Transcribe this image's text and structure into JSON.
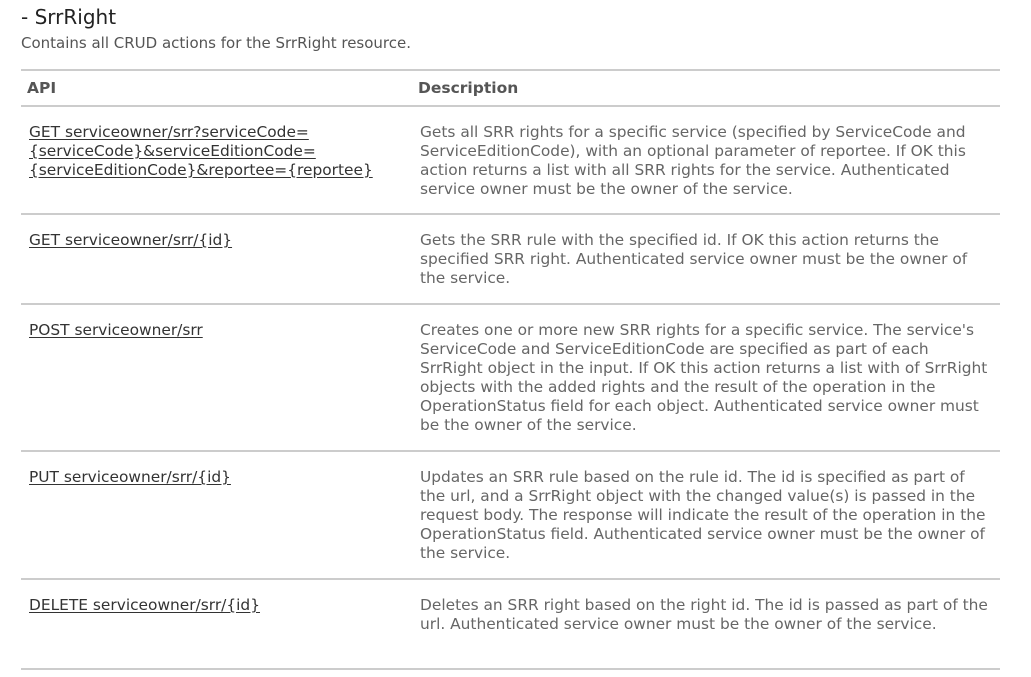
{
  "section": {
    "title": "- SrrRight",
    "description": "Contains all CRUD actions for the SrrRight resource."
  },
  "table": {
    "headers": {
      "api": "API",
      "description": "Description"
    },
    "rows": [
      {
        "api": "GET serviceowner/srr?serviceCode=\n{serviceCode}&serviceEditionCode=\n{serviceEditionCode}&reportee={reportee}",
        "description": "Gets all SRR rights for a specific service (specified by ServiceCode and ServiceEditionCode), with an optional parameter of reportee. If OK this action returns a list with all SRR rights for the service. Authenticated service owner must be the owner of the service."
      },
      {
        "api": "GET serviceowner/srr/{id}",
        "description": "Gets the SRR rule with the specified id. If OK this action returns the specified SRR right. Authenticated service owner must be the owner of the service."
      },
      {
        "api": "POST serviceowner/srr",
        "description": "Creates one or more new SRR rights for a specific service. The service's ServiceCode and ServiceEditionCode are specified as part of each SrrRight object in the input. If OK this action returns a list with of SrrRight objects with the added rights and the result of the operation in the OperationStatus field for each object. Authenticated service owner must be the owner of the service."
      },
      {
        "api": "PUT serviceowner/srr/{id}",
        "description": "Updates an SRR rule based on the rule id. The id is specified as part of the url, and a SrrRight object with the changed value(s) is passed in the request body. The response will indicate the result of the operation in the OperationStatus field. Authenticated service owner must be the owner of the service."
      },
      {
        "api": "DELETE serviceowner/srr/{id}",
        "description": "Deletes an SRR right based on the right id. The id is passed as part of the url. Authenticated service owner must be the owner of the service."
      }
    ]
  }
}
